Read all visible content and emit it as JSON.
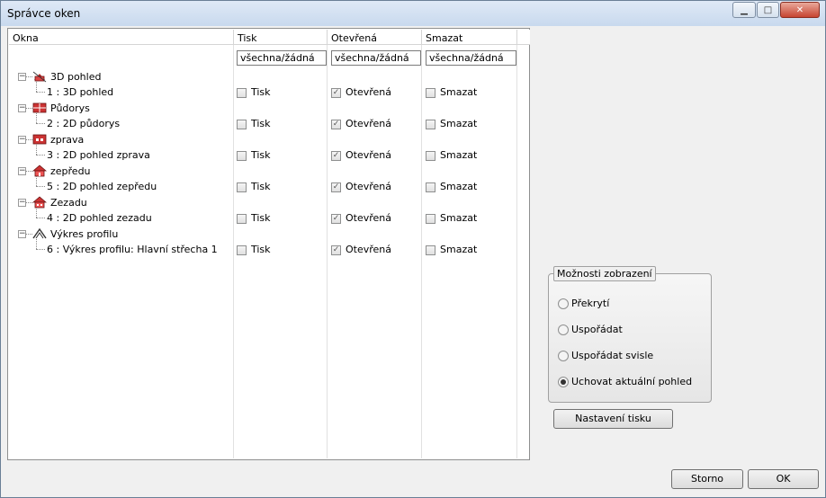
{
  "window": {
    "title": "Správce oken"
  },
  "columns": {
    "windows": "Okna",
    "print": "Tisk",
    "open": "Otevřená",
    "delete": "Smazat"
  },
  "all_none": {
    "print": "všechna/žádná",
    "open": "všechna/žádná",
    "delete": "všechna/žádná"
  },
  "tree": [
    {
      "group": "3D pohled",
      "icon": "3d-view-icon",
      "item": "1 : 3D pohled",
      "print_label": "Tisk",
      "print": false,
      "open_label": "Otevřená",
      "open": true,
      "delete_label": "Smazat",
      "delete": false
    },
    {
      "group": "Půdorys",
      "icon": "floor-plan-icon",
      "item": "2 : 2D půdorys",
      "print_label": "Tisk",
      "print": false,
      "open_label": "Otevřená",
      "open": true,
      "delete_label": "Smazat",
      "delete": false
    },
    {
      "group": "zprava",
      "icon": "side-view-icon",
      "item": "3 : 2D pohled zprava",
      "print_label": "Tisk",
      "print": false,
      "open_label": "Otevřená",
      "open": true,
      "delete_label": "Smazat",
      "delete": false
    },
    {
      "group": "zepředu",
      "icon": "front-view-icon",
      "item": "5 : 2D pohled zepředu",
      "print_label": "Tisk",
      "print": false,
      "open_label": "Otevřená",
      "open": true,
      "delete_label": "Smazat",
      "delete": false
    },
    {
      "group": "Zezadu",
      "icon": "rear-view-icon",
      "item": "4 : 2D pohled zezadu",
      "print_label": "Tisk",
      "print": false,
      "open_label": "Otevřená",
      "open": true,
      "delete_label": "Smazat",
      "delete": false
    },
    {
      "group": "Výkres profilu",
      "icon": "roof-profile-icon",
      "item": "6 : Výkres profilu: Hlavní střecha 1",
      "print_label": "Tisk",
      "print": false,
      "open_label": "Otevřená",
      "open": true,
      "delete_label": "Smazat",
      "delete": false
    }
  ],
  "display_options": {
    "title": "Možnosti zobrazení",
    "options": [
      "Překrytí",
      "Uspořádat",
      "Uspořádat svisle",
      "Uchovat aktuální pohled"
    ],
    "selected": "Uchovat aktuální pohled"
  },
  "buttons": {
    "print_settings": "Nastavení tisku",
    "cancel": "Storno",
    "ok": "OK"
  },
  "colors": {
    "accent": "#c74431",
    "titlebar": "#c8d9ee"
  }
}
